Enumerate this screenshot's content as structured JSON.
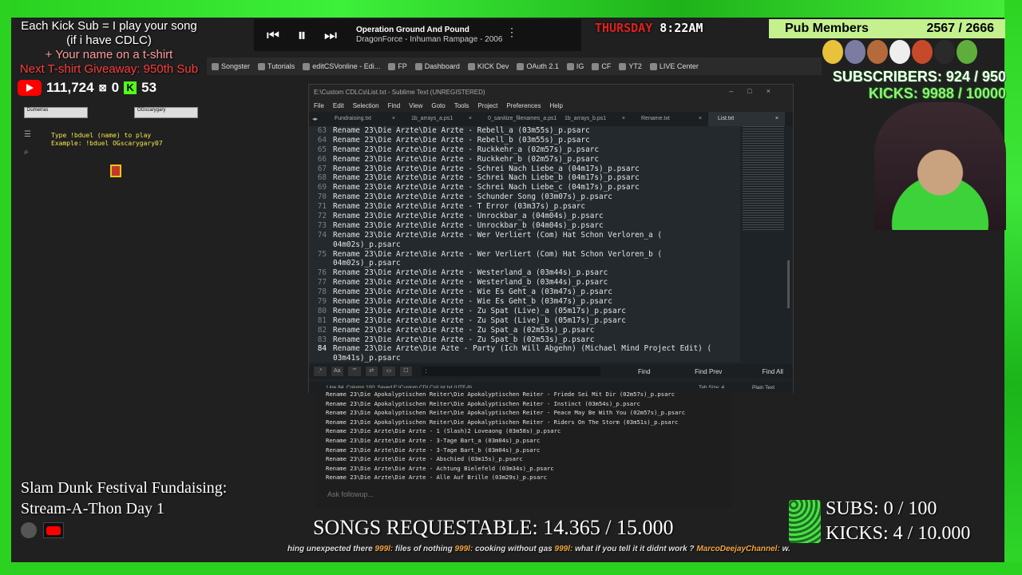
{
  "overlay": {
    "promo": {
      "line1": "Each Kick Sub = I play your song",
      "line2": "(if i have CDLC)",
      "line3": "+ Your name on a t-shirt",
      "line4": "Next T-shirt Giveaway: 950th Sub"
    },
    "stats": {
      "youtube_count": "111,724",
      "viewers": "0",
      "kick_count": "53"
    },
    "duel": {
      "line1": "Type !bduel (name) to play",
      "line2": "Example: !bduel OGscarygary07"
    },
    "mini_cards": [
      "Dumerras",
      "OGscarygary"
    ],
    "date": {
      "day": "THURSDAY",
      "time": "8:22AM"
    },
    "pub": {
      "label": "Pub Members",
      "count": "2567 / 2666"
    },
    "subscribers": "SUBSCRIBERS: 924 / 950",
    "kicks": "KICKS: 9988 / 10000",
    "fundraiser": {
      "line1": "Slam Dunk Festival Fundaising:",
      "line2": "Stream-A-Thon Day 1"
    },
    "songs_requestable": "SONGS REQUESTABLE: 14.365 / 15.000",
    "goals": {
      "subs": "SUBS:  0 / 100",
      "kicks": "KICKS: 4 / 10.000"
    },
    "ticker": [
      {
        "user": "",
        "text": "hing unexpected there "
      },
      {
        "user": "999l: ",
        "text": "files of nothing "
      },
      {
        "user": "999l: ",
        "text": "cooking without gas "
      },
      {
        "user": "999l: ",
        "text": "what if you tell it it didnt work ?  "
      },
      {
        "user": "MarcoDeejayChannel: ",
        "text": "w."
      }
    ]
  },
  "player": {
    "title": "Operation Ground And Pound",
    "artist": "DragonForce - Inhuman Rampage - 2006"
  },
  "bookmarks": [
    "Songster",
    "Tutorials",
    "editCSVonline - Edi...",
    "FP",
    "Dashboard",
    "KICK Dev",
    "OAuth 2.1",
    "IG",
    "CF",
    "YT2",
    "LIVE Center"
  ],
  "sublime": {
    "title": "E:\\Custom CDLCs\\List.txt - Sublime Text (UNREGISTERED)",
    "menu": [
      "File",
      "Edit",
      "Selection",
      "Find",
      "View",
      "Goto",
      "Tools",
      "Project",
      "Preferences",
      "Help"
    ],
    "tabs": [
      "Fundraising.txt",
      "1b_arrays_a.ps1",
      "0_sanitize_filenames_a.ps1",
      "1b_arrays_b.ps1",
      "Rename.txt",
      "List.txt"
    ],
    "lines": [
      {
        "n": "63",
        "t": "Rename 23\\Die Arzte\\Die Arzte - Rebell_a (03m55s)_p.psarc"
      },
      {
        "n": "64",
        "t": "Rename 23\\Die Arzte\\Die Arzte - Rebell_b (03m55s)_p.psarc"
      },
      {
        "n": "65",
        "t": "Rename 23\\Die Arzte\\Die Arzte - Ruckkehr_a (02m57s)_p.psarc"
      },
      {
        "n": "66",
        "t": "Rename 23\\Die Arzte\\Die Arzte - Ruckkehr_b (02m57s)_p.psarc"
      },
      {
        "n": "67",
        "t": "Rename 23\\Die Arzte\\Die Arzte - Schrei Nach Liebe_a (04m17s)_p.psarc"
      },
      {
        "n": "68",
        "t": "Rename 23\\Die Arzte\\Die Arzte - Schrei Nach Liebe_b (04m17s)_p.psarc"
      },
      {
        "n": "69",
        "t": "Rename 23\\Die Arzte\\Die Arzte - Schrei Nach Liebe_c (04m17s)_p.psarc"
      },
      {
        "n": "70",
        "t": "Rename 23\\Die Arzte\\Die Arzte - Schunder Song (03m07s)_p.psarc"
      },
      {
        "n": "71",
        "t": "Rename 23\\Die Arzte\\Die Arzte - T Error (03m37s)_p.psarc"
      },
      {
        "n": "72",
        "t": "Rename 23\\Die Arzte\\Die Arzte - Unrockbar_a (04m04s)_p.psarc"
      },
      {
        "n": "73",
        "t": "Rename 23\\Die Arzte\\Die Arzte - Unrockbar_b (04m04s)_p.psarc"
      },
      {
        "n": "74",
        "t": "Rename 23\\Die Arzte\\Die Arzte - Wer Verliert (Com) Hat Schon Verloren_a ("
      },
      {
        "n": "",
        "t": "04m02s)_p.psarc"
      },
      {
        "n": "75",
        "t": "Rename 23\\Die Arzte\\Die Arzte - Wer Verliert (Com) Hat Schon Verloren_b ("
      },
      {
        "n": "",
        "t": "04m02s)_p.psarc"
      },
      {
        "n": "76",
        "t": "Rename 23\\Die Arzte\\Die Arzte - Westerland_a (03m44s)_p.psarc"
      },
      {
        "n": "77",
        "t": "Rename 23\\Die Arzte\\Die Arzte - Westerland_b (03m44s)_p.psarc"
      },
      {
        "n": "78",
        "t": "Rename 23\\Die Arzte\\Die Arzte - Wie Es Geht_a (03m47s)_p.psarc"
      },
      {
        "n": "79",
        "t": "Rename 23\\Die Arzte\\Die Arzte - Wie Es Geht_b (03m47s)_p.psarc"
      },
      {
        "n": "80",
        "t": "Rename 23\\Die Arzte\\Die Arzte - Zu Spat (Live)_a (05m17s)_p.psarc"
      },
      {
        "n": "81",
        "t": "Rename 23\\Die Arzte\\Die Arzte - Zu Spat (Live)_b (05m17s)_p.psarc"
      },
      {
        "n": "82",
        "t": "Rename 23\\Die Arzte\\Die Arzte - Zu Spat_a (02m53s)_p.psarc"
      },
      {
        "n": "83",
        "t": "Rename 23\\Die Arzte\\Die Arzte - Zu Spat_b (02m53s)_p.psarc"
      },
      {
        "n": "84",
        "t": "Rename 23\\Die Arzte\\Die Azte - Party (Ich Will Abgehn) (Michael Mind Project Edit) ("
      },
      {
        "n": "",
        "t": "03m41s)_p.psarc"
      }
    ],
    "current_line": "84",
    "find": {
      "field": ":",
      "find": "Find",
      "find_prev": "Find Prev",
      "find_all": "Find All"
    },
    "status": {
      "left": "Line 84, Column 100; Saved E:\\Custom CDLCs\\List.txt (UTF-8)",
      "tab": "Tab Size: 4",
      "syntax": "Plain Text"
    }
  },
  "console": {
    "lines": [
      "Rename 23\\Die Apokalyptischen Reiter\\Die Apokalyptischen Reiter - Friede Sei Mit Dir (02m57s)_p.psarc",
      "Rename 23\\Die Apokalyptischen Reiter\\Die Apokalyptischen Reiter - Instinct (03m54s)_p.psarc",
      "Rename 23\\Die Apokalyptischen Reiter\\Die Apokalyptischen Reiter - Peace May Be With You (02m57s)_p.psarc",
      "Rename 23\\Die Apokalyptischen Reiter\\Die Apokalyptischen Reiter - Riders On The Storm (03m51s)_p.psarc",
      "Rename 23\\Die Arzte\\Die Arzte - 1 (Slash)2 Loveaong (03m58s)_p.psarc",
      "Rename 23\\Die Arzte\\Die Arzte - 3-Tage Bart_a (03m04s)_p.psarc",
      "Rename 23\\Die Arzte\\Die Arzte - 3-Tage Bart_b (03m04s)_p.psarc",
      "Rename 23\\Die Arzte\\Die Arzte - Abschied (03m15s)_p.psarc",
      "Rename 23\\Die Arzte\\Die Arzte - Achtung Bielefeld (03m34s)_p.psarc",
      "Rename 23\\Die Arzte\\Die Arzte - Alle Auf Brille (03m29s)_p.psarc"
    ],
    "placeholder": "Ask followup..."
  }
}
